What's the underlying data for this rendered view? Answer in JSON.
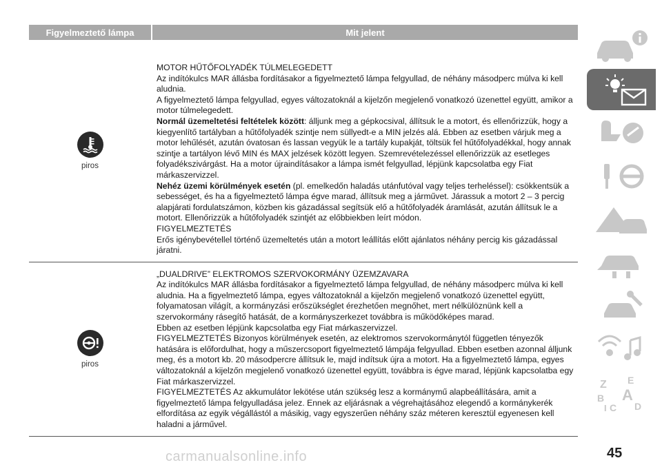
{
  "table": {
    "header_col1": "Figyelmeztető lámpa",
    "header_col2": "Mit jelent",
    "rows": [
      {
        "icon_caption": "piros",
        "title": "MOTOR HŰTŐFOLYADÉK TÚLMELEGEDETT",
        "p1": "Az indítókulcs MAR állásba fordításakor a figyelmeztető lámpa felgyullad, de néhány másodperc múlva ki kell aludnia.",
        "p2": "A figyelmeztető lámpa felgyullad, egyes változatoknál a kijelzőn megjelenő vonatkozó üzenettel együtt, amikor a motor túlmelegedett.",
        "p3_bold": "Normál üzemeltetési feltételek között",
        "p3_rest": ": álljunk meg a gépkocsival, állítsuk le a motort, és ellenőrizzük, hogy a kiegyenlítő tartályban a hűtőfolyadék szintje nem süllyedt-e a MIN jelzés alá. Ebben az esetben várjuk meg a motor lehűlését, azután óvatosan és lassan vegyük le a tartály kupakját, töltsük fel hűtőfolyadékkal, hogy annak szintje a tartályon lévő MIN és MAX jelzések között legyen. Szemrevételezéssel ellenőrizzük az esetleges folyadékszivárgást. Ha a motor újraindításakor a lámpa ismét felgyullad, lépjünk kapcsolatba egy Fiat márkaszervizzel.",
        "p4_bold": "Nehéz üzemi körülmények esetén",
        "p4_rest": " (pl. emelkedőn haladás utánfutóval vagy teljes terheléssel): csökkentsük a sebességet, és ha a figyelmeztető lámpa égve marad, állítsuk meg a járművet. Járassuk a motort 2 – 3 percig alapjárati fordulatszámon, közben kis gázadással segítsük elő a hűtőfolyadék áramlását, azután állítsuk le a motort. Ellenőrizzük a hűtőfolyadék szintjét az előbbiekben leírt módon.",
        "warn_title": "FIGYELMEZTETÉS",
        "warn_text": "Erős igénybevétellel történő üzemeltetés után a motort leállítás előtt ajánlatos néhány percig kis gázadással járatni."
      },
      {
        "icon_caption": "piros",
        "title": "„DUALDRIVE” ELEKTROMOS SZERVOKORMÁNY ÜZEMZAVARA",
        "p1": "Az indítókulcs MAR állásba fordításakor a figyelmeztető lámpa felgyullad, de néhány másodperc múlva ki kell aludnia. Ha a figyelmeztető lámpa, egyes változatoknál a kijelzőn megjelenő vonatkozó üzenettel együtt, folyamatosan világít, a kormányzási erőszükséglet érezhetően megnőhet, mert nélkülöznünk kell a szervokormány rásegítő hatását, de a kormányszerkezet továbbra is működőképes marad.",
        "p2": "Ebben az esetben lépjünk kapcsolatba egy Fiat márkaszervizzel.",
        "p3": "FIGYELMEZTETÉS Bizonyos körülmények esetén, az elektromos szervokormánytól független tényezők hatására is előfordulhat, hogy a műszercsoport figyelmeztető lámpája felgyullad. Ebben esetben azonnal álljunk meg, és a motort kb. 20 másodpercre állítsuk le, majd indítsuk újra a motort. Ha a figyelmeztető lámpa, egyes változatoknál a kijelzőn megjelenő vonatkozó üzenettel együtt, továbbra is égve marad, lépjünk kapcsolatba egy Fiat márkaszervizzel.",
        "p4": "FIGYELMEZTETÉS Az akkumulátor lekötése után szükség lesz a kormánymű alapbeállítására, amit a figyelmeztető lámpa felgyulladása jelez. Ennek az eljárásnak a végrehajtásához elegendő a kormánykerék elfordítása az egyik végállástól a másikig, vagy egyszerűen néhány száz méteren keresztül egyenesen kell haladni a járművel."
      }
    ]
  },
  "sidebar": {
    "letters": [
      "Z",
      "E",
      "A",
      "B",
      "C",
      "D",
      "I"
    ]
  },
  "page_number": "45",
  "watermark": "carmanualsonline.info",
  "colors": {
    "header_bg": "#a9a9a9",
    "active_tab": "#6b6b6b",
    "icon_bg": "#2a2a2a"
  }
}
